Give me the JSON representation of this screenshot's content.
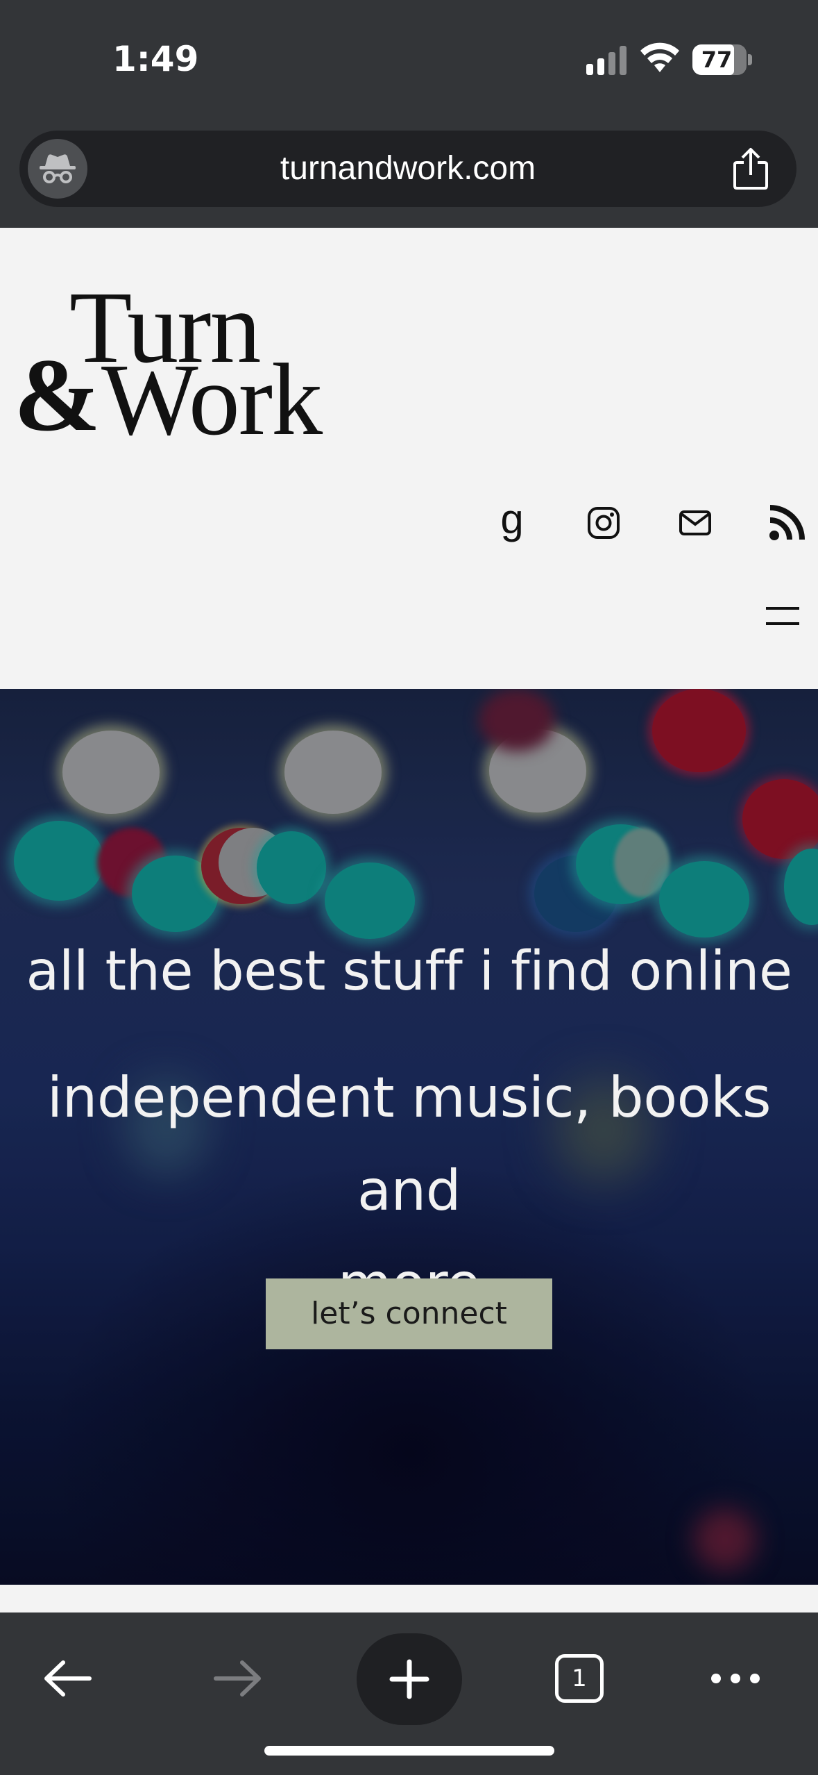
{
  "status_bar": {
    "time": "1:49",
    "battery": "77",
    "battery_level": 0.77,
    "icons": [
      "cellular-signal-icon",
      "wifi-icon",
      "battery-icon"
    ]
  },
  "browser": {
    "url": "turnandwork.com",
    "mode": "incognito",
    "tab_count": "1",
    "toolbar_icons": [
      "back-arrow-icon",
      "forward-arrow-icon",
      "plus-icon",
      "tabs-icon",
      "more-icon"
    ]
  },
  "site": {
    "logo": {
      "line1": "Turn",
      "amp": "&",
      "line2": "Work"
    },
    "social": [
      {
        "name": "goodreads",
        "glyph": "g"
      },
      {
        "name": "instagram",
        "icon": "instagram-icon"
      },
      {
        "name": "email",
        "icon": "mail-icon"
      },
      {
        "name": "rss",
        "icon": "rss-icon"
      }
    ],
    "menu_icon": "hamburger-menu-icon"
  },
  "hero": {
    "tagline": "all the best stuff i find online",
    "subtitle_line1": "independent music, books and",
    "subtitle_line2": "more",
    "cta_label": "let’s connect",
    "colors": {
      "cta_background": "#adb59e",
      "text": "#f2f2f2"
    }
  },
  "colors": {
    "chrome": "#333538",
    "url_bar": "#202124",
    "page_background": "#f3f3f3"
  }
}
